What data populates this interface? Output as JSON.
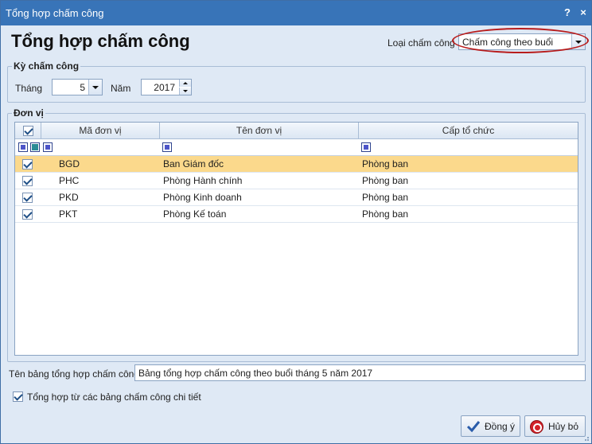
{
  "window": {
    "title": "Tổng hợp chấm công",
    "help_icon": "?",
    "close_icon": "×"
  },
  "header": {
    "title": "Tổng hợp chấm công",
    "type_label": "Loại chấm công",
    "type_value": "Chấm công theo buổi"
  },
  "period": {
    "group_title": "Kỳ chấm công",
    "month_label": "Tháng",
    "month_value": "5",
    "year_label": "Năm",
    "year_value": "2017"
  },
  "units": {
    "group_title": "Đơn vị",
    "columns": [
      "Mã đơn vị",
      "Tên đơn vị",
      "Cấp tổ chức"
    ],
    "rows": [
      {
        "checked": true,
        "code": "BGD",
        "name": "Ban Giám đốc",
        "level": "Phòng ban",
        "selected": true
      },
      {
        "checked": true,
        "code": "PHC",
        "name": "Phòng Hành chính",
        "level": "Phòng ban",
        "selected": false
      },
      {
        "checked": true,
        "code": "PKD",
        "name": "Phòng Kinh doanh",
        "level": "Phòng ban",
        "selected": false
      },
      {
        "checked": true,
        "code": "PKT",
        "name": "Phòng Kế toán",
        "level": "Phòng ban",
        "selected": false
      }
    ]
  },
  "summary": {
    "name_label": "Tên bảng tổng hợp chấm công",
    "name_value": "Bảng tổng hợp chấm công theo buổi tháng 5 năm 2017",
    "detail_checkbox_label": "Tổng hợp từ các bảng chấm công chi tiết",
    "detail_checked": true
  },
  "buttons": {
    "ok": "Đồng ý",
    "cancel": "Hủy bỏ"
  },
  "colors": {
    "titlebar": "#3874b8",
    "selected_row": "#fbd98c",
    "highlight_oval": "#b81c1c"
  }
}
